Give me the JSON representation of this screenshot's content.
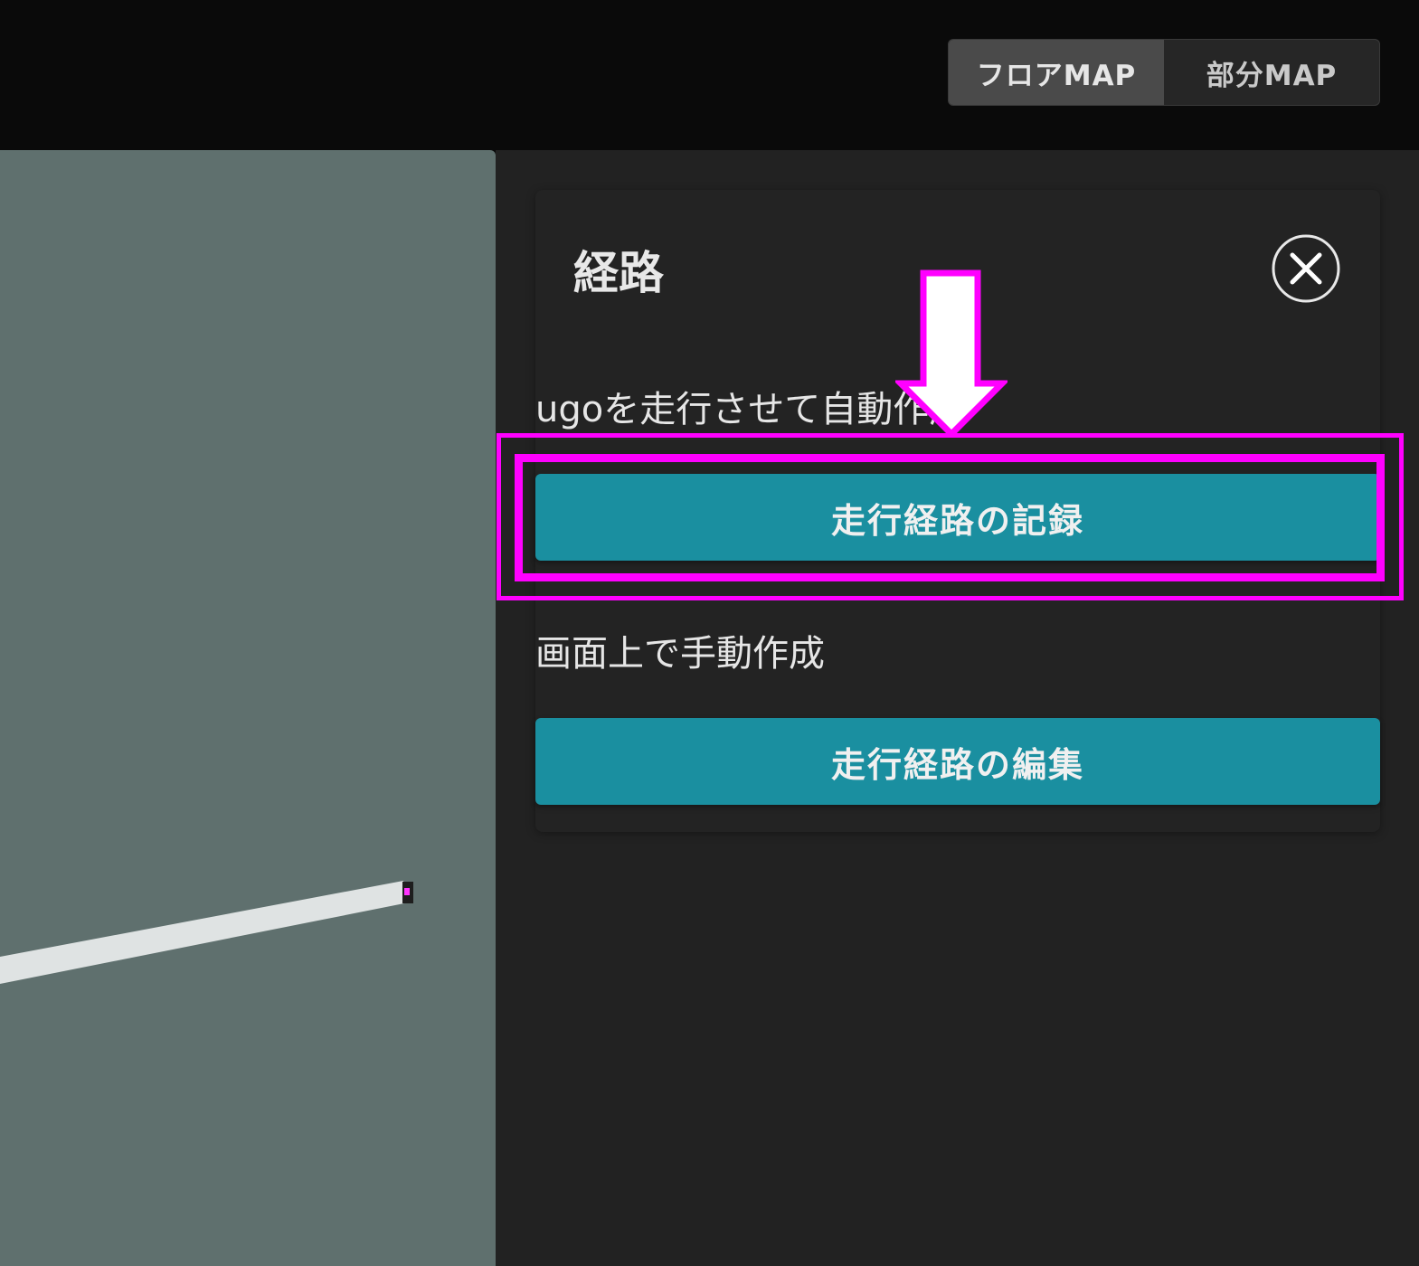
{
  "header": {
    "map_toggle": {
      "floor_map": "フロアMAP",
      "partial_map": "部分MAP",
      "selected": "フロアMAP"
    }
  },
  "route_panel": {
    "title": "経路",
    "auto_section_label": "ugoを走行させて自動作成",
    "record_button": "走行経路の記録",
    "manual_section_label": "画面上で手動作成",
    "edit_button": "走行経路の編集"
  },
  "annotation": {
    "highlight_color": "#ff00ff"
  },
  "colors": {
    "accent": "#1a8fa0",
    "map_background": "#5f706e",
    "panel_background": "#232323"
  }
}
